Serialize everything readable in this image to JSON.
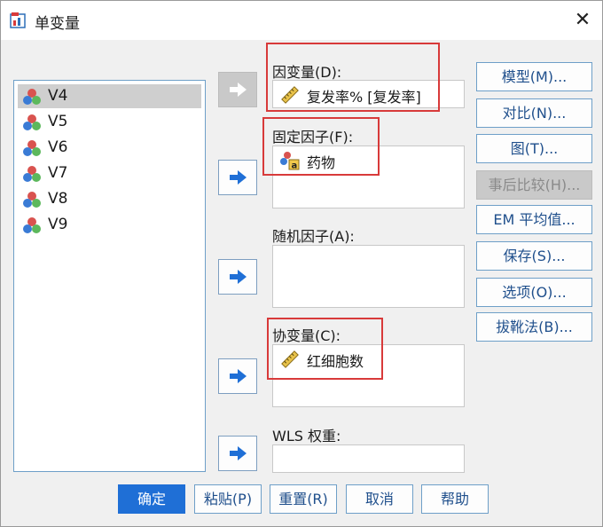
{
  "window": {
    "title": "单变量",
    "close_glyph": "✕"
  },
  "variables": [
    "V4",
    "V5",
    "V6",
    "V7",
    "V8",
    "V9"
  ],
  "selected_variable": "V4",
  "fields": {
    "dependent": {
      "label": "因变量(D):",
      "items": [
        "复发率% [复发率]"
      ]
    },
    "fixed": {
      "label": "固定因子(F):",
      "items": [
        "药物"
      ]
    },
    "random": {
      "label": "随机因子(A):",
      "items": []
    },
    "covariate": {
      "label": "协变量(C):",
      "items": [
        "红细胞数"
      ]
    },
    "wls": {
      "label": "WLS 权重:",
      "items": []
    }
  },
  "side_buttons": [
    "模型(M)...",
    "对比(N)...",
    "图(T)...",
    "事后比较(H)...",
    "EM 平均值...",
    "保存(S)...",
    "选项(O)...",
    "拔靴法(B)..."
  ],
  "bottom_buttons": [
    "确定",
    "粘贴(P)",
    "重置(R)",
    "取消",
    "帮助"
  ],
  "colors": {
    "accent": "#1f6fd6",
    "highlight_box": "#d83a3a",
    "arrow": "#1f6fd6"
  },
  "icons": {
    "variable": "nominal-variable-icon",
    "scale": "ruler-icon",
    "factor": "factor-variable-icon"
  }
}
